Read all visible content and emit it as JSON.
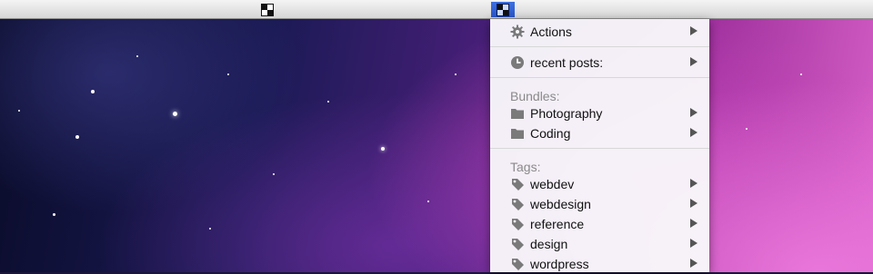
{
  "menubar": {
    "items": [
      {
        "name": "app-status-icon",
        "state": "inactive"
      },
      {
        "name": "app-status-icon",
        "state": "active"
      }
    ]
  },
  "menu": {
    "actions": {
      "label": "Actions",
      "icon": "gear-icon"
    },
    "recent": {
      "label": "recent posts:",
      "icon": "clock-icon"
    },
    "bundles_header": "Bundles:",
    "bundles": [
      {
        "label": "Photography",
        "icon": "folder-icon"
      },
      {
        "label": "Coding",
        "icon": "folder-icon"
      }
    ],
    "tags_header": "Tags:",
    "tags": [
      {
        "label": "webdev",
        "icon": "tag-icon"
      },
      {
        "label": "webdesign",
        "icon": "tag-icon"
      },
      {
        "label": "reference",
        "icon": "tag-icon"
      },
      {
        "label": "design",
        "icon": "tag-icon"
      },
      {
        "label": "wordpress",
        "icon": "tag-icon"
      }
    ]
  },
  "colors": {
    "menu_text": "#111111",
    "header_text": "#8a8a8a",
    "icon_gray": "#7a7a7a",
    "menubar_highlight": "#2a55c8"
  }
}
